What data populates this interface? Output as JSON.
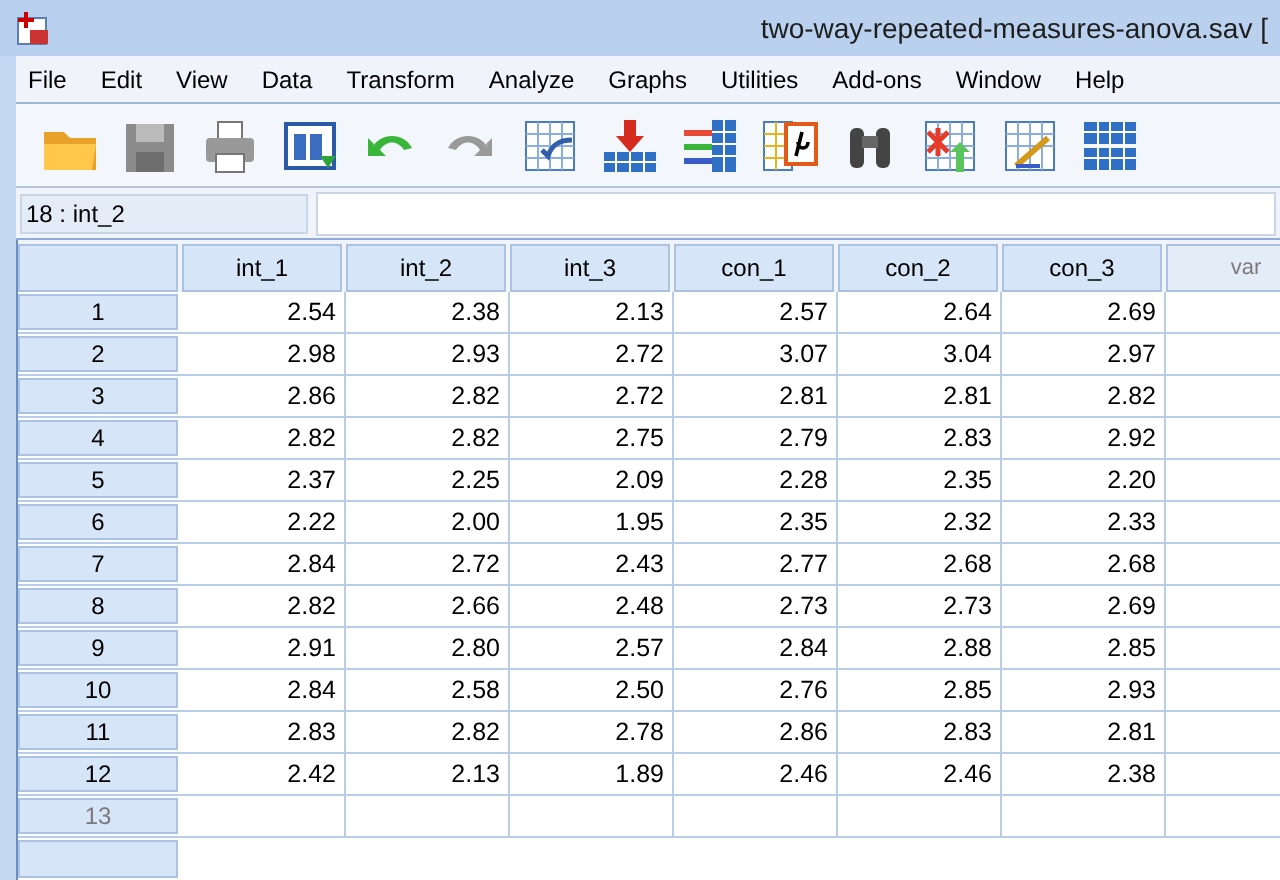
{
  "window": {
    "title": "two-way-repeated-measures-anova.sav ["
  },
  "menu": [
    "File",
    "Edit",
    "View",
    "Data",
    "Transform",
    "Analyze",
    "Graphs",
    "Utilities",
    "Add-ons",
    "Window",
    "Help"
  ],
  "cell_reference": "18 : int_2",
  "columns": [
    {
      "label": "int_1",
      "defined": true
    },
    {
      "label": "int_2",
      "defined": true
    },
    {
      "label": "int_3",
      "defined": true
    },
    {
      "label": "con_1",
      "defined": true
    },
    {
      "label": "con_2",
      "defined": true
    },
    {
      "label": "con_3",
      "defined": true
    },
    {
      "label": "var",
      "defined": false
    }
  ],
  "rows": [
    {
      "label": "1",
      "defined": true,
      "values": [
        "2.54",
        "2.38",
        "2.13",
        "2.57",
        "2.64",
        "2.69"
      ]
    },
    {
      "label": "2",
      "defined": true,
      "values": [
        "2.98",
        "2.93",
        "2.72",
        "3.07",
        "3.04",
        "2.97"
      ]
    },
    {
      "label": "3",
      "defined": true,
      "values": [
        "2.86",
        "2.82",
        "2.72",
        "2.81",
        "2.81",
        "2.82"
      ]
    },
    {
      "label": "4",
      "defined": true,
      "values": [
        "2.82",
        "2.82",
        "2.75",
        "2.79",
        "2.83",
        "2.92"
      ]
    },
    {
      "label": "5",
      "defined": true,
      "values": [
        "2.37",
        "2.25",
        "2.09",
        "2.28",
        "2.35",
        "2.20"
      ]
    },
    {
      "label": "6",
      "defined": true,
      "values": [
        "2.22",
        "2.00",
        "1.95",
        "2.35",
        "2.32",
        "2.33"
      ]
    },
    {
      "label": "7",
      "defined": true,
      "values": [
        "2.84",
        "2.72",
        "2.43",
        "2.77",
        "2.68",
        "2.68"
      ]
    },
    {
      "label": "8",
      "defined": true,
      "values": [
        "2.82",
        "2.66",
        "2.48",
        "2.73",
        "2.73",
        "2.69"
      ]
    },
    {
      "label": "9",
      "defined": true,
      "values": [
        "2.91",
        "2.80",
        "2.57",
        "2.84",
        "2.88",
        "2.85"
      ]
    },
    {
      "label": "10",
      "defined": true,
      "values": [
        "2.84",
        "2.58",
        "2.50",
        "2.76",
        "2.85",
        "2.93"
      ]
    },
    {
      "label": "11",
      "defined": true,
      "values": [
        "2.83",
        "2.82",
        "2.78",
        "2.86",
        "2.83",
        "2.81"
      ]
    },
    {
      "label": "12",
      "defined": true,
      "values": [
        "2.42",
        "2.13",
        "1.89",
        "2.46",
        "2.46",
        "2.38"
      ]
    },
    {
      "label": "13",
      "defined": false,
      "values": []
    }
  ]
}
